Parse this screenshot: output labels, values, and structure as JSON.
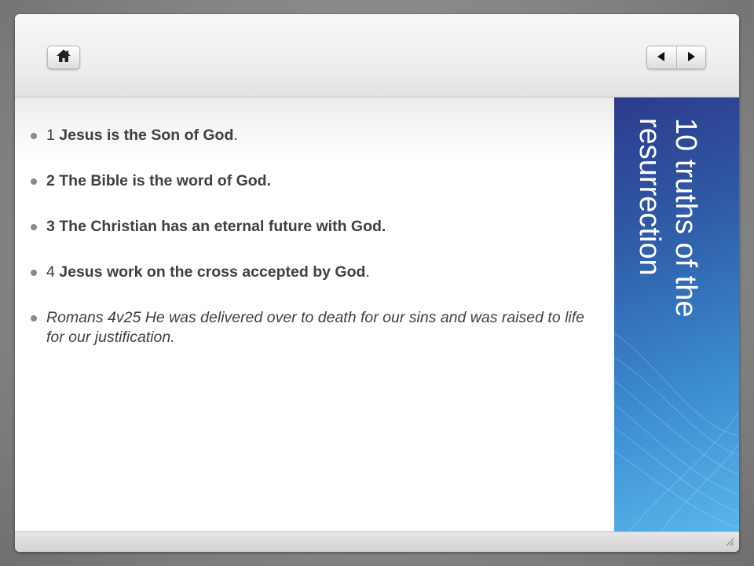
{
  "slide": {
    "title": "10 truths of the\nresurrection",
    "bullets": {
      "b1": {
        "num": "1 ",
        "bold": "Jesus is the Son of God",
        "end": "."
      },
      "b2": {
        "text": "2 The Bible is the word of God."
      },
      "b3": {
        "text": "3 The Christian has an eternal future with God."
      },
      "b4": {
        "num": "4 ",
        "bold": "Jesus work on the cross accepted by God",
        "end": "."
      },
      "b5": {
        "text": "Romans 4v25 He was delivered over to death for our sins and was raised to life for our justification."
      }
    }
  },
  "icons": {
    "home": "home-icon",
    "previous": "arrow-left-icon",
    "next": "arrow-right-icon",
    "resize": "resize-grip-icon"
  },
  "colors": {
    "sidebar_dark": "#2e3a8c",
    "sidebar_light": "#59b6ea",
    "text": "#404040"
  }
}
